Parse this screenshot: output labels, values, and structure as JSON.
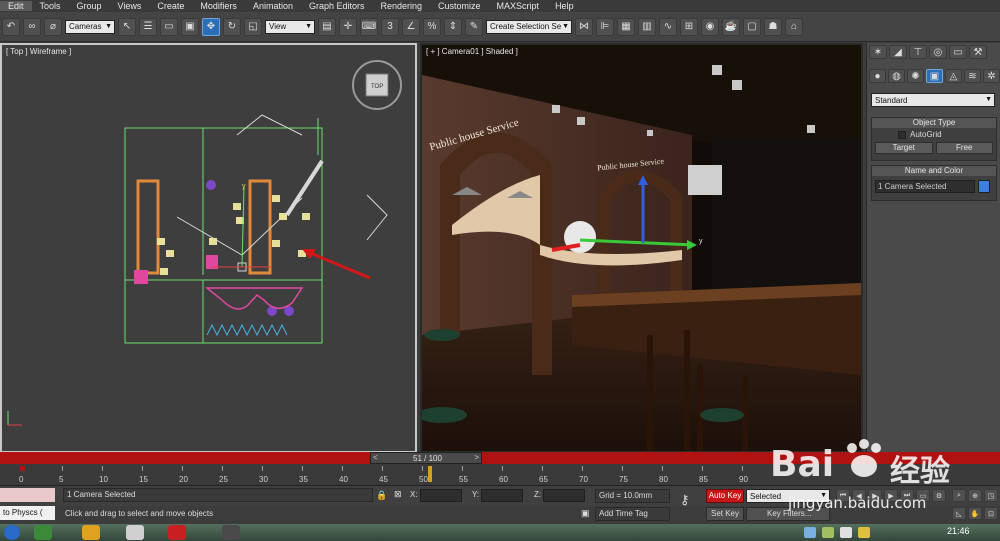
{
  "menubar": {
    "items": [
      "Edit",
      "Tools",
      "Group",
      "Views",
      "Create",
      "Modifiers",
      "Animation",
      "Graph Editors",
      "Rendering",
      "Customize",
      "MAXScript",
      "Help"
    ]
  },
  "toolbar": {
    "selection_filter": "Cameras",
    "ref_coord": "View",
    "named_selection": "Create Selection Se",
    "snap_label": "3"
  },
  "viewports": {
    "left_label": "[ Top ] Wireframe ]",
    "right_label": "[ + ] Camera01 ] Shaded ]",
    "viewcube_label": "TOP",
    "sign_text_1": "Public house Service",
    "sign_text_2": "Public house Service",
    "axis_y": "y",
    "axis_y2": "y"
  },
  "panel": {
    "dropdown": "Standard",
    "object_type_title": "Object Type",
    "autogrid_label": "AutoGrid",
    "target_button": "Target",
    "free_button": "Free",
    "name_color_title": "Name and Color",
    "name_value": "1 Camera Selected",
    "name_color": "#3d7fe0"
  },
  "timeline": {
    "frame_label": "51 / 100",
    "ticks": [
      "0",
      "5",
      "10",
      "15",
      "20",
      "25",
      "30",
      "35",
      "40",
      "45",
      "50",
      "55",
      "60",
      "65",
      "70",
      "75",
      "80",
      "85",
      "90"
    ],
    "current_frame": 51,
    "total_frames": 100
  },
  "status": {
    "script_field": "to Physcs (",
    "selected_text": "1 Camera Selected",
    "prompt_text": "Click and drag to select and move objects",
    "x_label": "X:",
    "y_label": "Y:",
    "z_label": "Z:",
    "grid_text": "Grid = 10.0mm",
    "add_time_tag": "Add Time Tag",
    "auto_key": "Auto Key",
    "set_key": "Set Key",
    "key_filter": "Selected",
    "key_filter_btn": "Key Filters..."
  },
  "taskbar": {
    "clock": "21:46"
  },
  "watermark": {
    "brand": "Bai",
    "brand2": "百",
    "chinese": "经验",
    "url": "jingyan.baidu.com"
  },
  "colors": {
    "active_button": "#2c6fb5",
    "timeline_bar": "#b01212",
    "auto_key_red": "#c81414"
  }
}
